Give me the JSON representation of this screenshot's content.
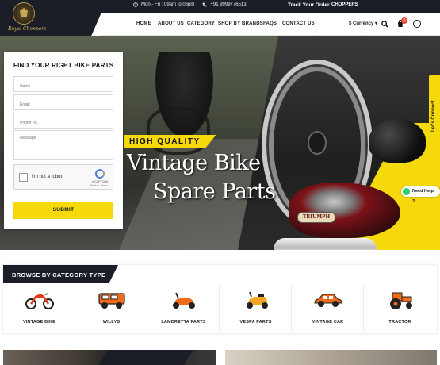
{
  "topbar": {
    "hours": "Mon - Fri : 09am to 06pm",
    "phone": "+91 9999776513",
    "track_order": "Track Your Order",
    "brand_link": "CHOPPERS"
  },
  "logo": {
    "text": "Royal Choppers"
  },
  "nav": {
    "items": [
      "HOME",
      "ABOUT US",
      "CATEGORY",
      "SHOP BY BRANDS",
      "FAQS",
      "CONTACT US"
    ],
    "currency": "$ Currency",
    "cart_count": "0"
  },
  "hero": {
    "tag": "HIGH QUALITY",
    "title_line1": "Vintage Bike",
    "title_line2": "Spare Parts",
    "tank_brand": "TRIUMPH"
  },
  "side": {
    "connect": "Let's Connect",
    "help": "Need Help ?"
  },
  "form": {
    "title": "FIND YOUR RIGHT BIKE PARTS",
    "name_placeholder": "Name",
    "email_placeholder": "Email",
    "phone_placeholder": "Phone no.",
    "message_placeholder": "Message",
    "captcha_label": "I'm not a robot",
    "captcha_brand": "reCAPTCHA",
    "captcha_links": "Privacy - Terms",
    "submit": "SUBMIT"
  },
  "categories": {
    "title": "BROWSE BY CATEGORY TYPE",
    "items": [
      {
        "label": "VINTAGE BIKE",
        "icon": "motorbike-icon"
      },
      {
        "label": "WILLYS",
        "icon": "jeep-icon"
      },
      {
        "label": "LAMBRETTA PARTS",
        "icon": "scooter-icon"
      },
      {
        "label": "VESPA PARTS",
        "icon": "vespa-icon"
      },
      {
        "label": "VINTAGE CAR",
        "icon": "car-icon"
      },
      {
        "label": "TRACTOR",
        "icon": "tractor-icon"
      }
    ]
  },
  "colors": {
    "accent": "#f5d90a",
    "dark": "#1b1e26",
    "icon_orange": "#f26a1b"
  }
}
